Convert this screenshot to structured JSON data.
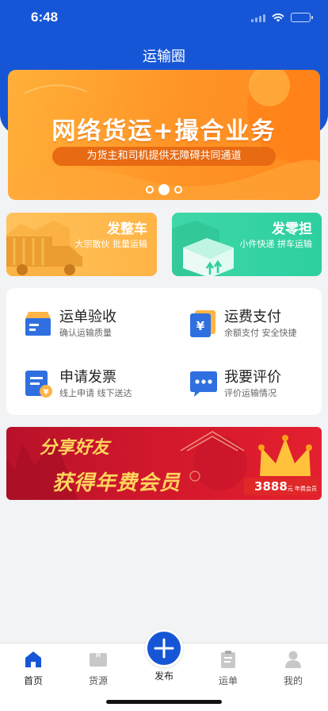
{
  "status": {
    "time": "6:48"
  },
  "header": {
    "title": "运输圈",
    "accent": "#1656d6"
  },
  "banner": {
    "title": "网络货运+撮合业务",
    "subtitle": "为货主和司机提供无障碍共同通道",
    "dots": 3,
    "active_dot": 2
  },
  "cards": [
    {
      "title": "发整车",
      "subtitle": "大宗散伙 批量运输",
      "icon": "truck-icon",
      "color": "#ffb445"
    },
    {
      "title": "发零担",
      "subtitle": "小件快递 拼车运输",
      "icon": "package-icon",
      "color": "#2ecf9f"
    }
  ],
  "services": [
    {
      "title": "运单验收",
      "subtitle": "确认运输质量",
      "icon": "box-check-icon"
    },
    {
      "title": "运费支付",
      "subtitle": "余额支付 安全快捷",
      "icon": "yen-payment-icon"
    },
    {
      "title": "申请发票",
      "subtitle": "线上申请 线下送达",
      "icon": "invoice-icon"
    },
    {
      "title": "我要评价",
      "subtitle": "评价运输情况",
      "icon": "comment-icon"
    }
  ],
  "promo": {
    "line1": "分享好友",
    "line2": "获得年费会员",
    "price": "3888",
    "price_unit": "元 年费会员"
  },
  "tabbar": {
    "items": [
      {
        "label": "首页",
        "icon": "home-icon",
        "active": true
      },
      {
        "label": "货源",
        "icon": "cargo-icon",
        "active": false
      },
      {
        "label": "发布",
        "icon": "plus-icon",
        "active": false
      },
      {
        "label": "运单",
        "icon": "clipboard-icon",
        "active": false
      },
      {
        "label": "我的",
        "icon": "user-icon",
        "active": false
      }
    ]
  }
}
